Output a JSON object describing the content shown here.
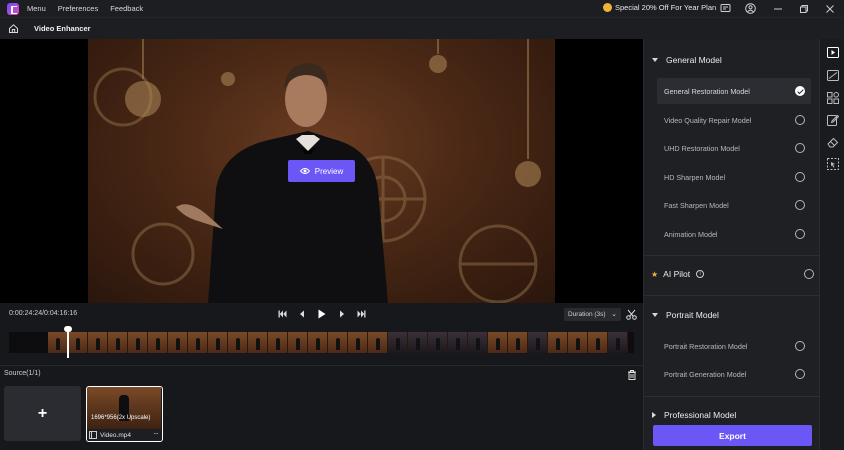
{
  "titlebar": {
    "menus": [
      "Menu",
      "Preferences",
      "Feedback"
    ],
    "promo": "Special 20% Off For Year Plan"
  },
  "toolbar": {
    "title": "Video Enhancer"
  },
  "preview": {
    "button_label": "Preview"
  },
  "playback": {
    "timecode": "0:00:24:24/0:04:16:16",
    "duration": "Duration (3s)"
  },
  "source": {
    "label": "Source(1/1)",
    "add_symbol": "+",
    "media": {
      "resolution": "1696*956(2x Upscale)",
      "name": "Video.mp4",
      "more": "···"
    }
  },
  "panel": {
    "general": {
      "title": "General Model",
      "options": [
        {
          "label": "General Restoration Model",
          "selected": true
        },
        {
          "label": "Video Quality Repair Model",
          "selected": false
        },
        {
          "label": "UHD Restoration Model",
          "selected": false
        },
        {
          "label": "HD Sharpen Model",
          "selected": false
        },
        {
          "label": "Fast Sharpen Model",
          "selected": false
        },
        {
          "label": "Animation Model",
          "selected": false
        }
      ]
    },
    "ai_pilot": {
      "label": "AI Pilot",
      "info": "i"
    },
    "portrait": {
      "title": "Portrait Model",
      "options": [
        {
          "label": "Portrait Restoration Model",
          "selected": false
        },
        {
          "label": "Portrait Generation Model",
          "selected": false
        }
      ]
    },
    "professional": {
      "title": "Professional Model"
    },
    "export_label": "Export"
  },
  "colors": {
    "accent": "#6b56f6",
    "star": "#f0b33a"
  }
}
